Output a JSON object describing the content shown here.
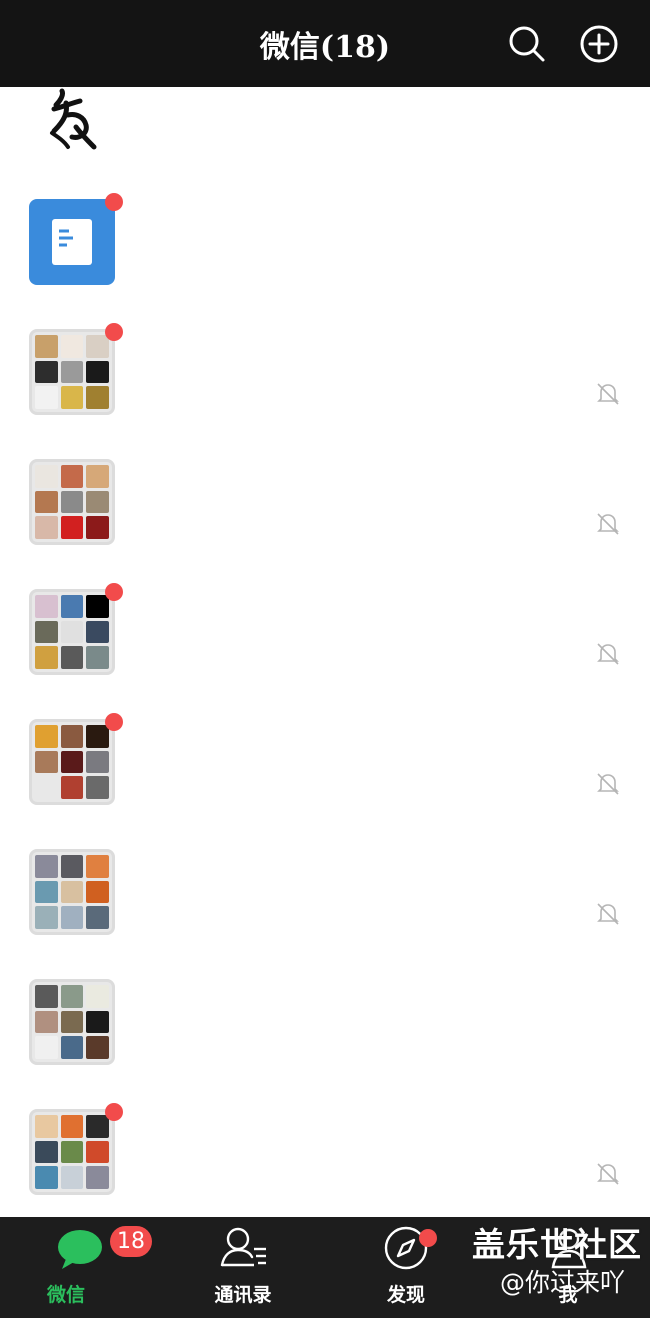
{
  "header": {
    "title": "微信(18)",
    "search_icon": "search-icon",
    "add_icon": "plus-circle-icon"
  },
  "colors": {
    "header_bg": "#141414",
    "tabbar_bg": "#1d1d1d",
    "accent_green": "#2bbf5d",
    "badge_red": "#f24b4b",
    "doc_avatar_blue": "#3a8bdc"
  },
  "chats": [
    {
      "avatar": "calligraphy-image",
      "unread_dot": false,
      "muted": false
    },
    {
      "avatar": "document-icon",
      "unread_dot": true,
      "muted": false
    },
    {
      "avatar": "group-grid",
      "unread_dot": true,
      "muted": true
    },
    {
      "avatar": "group-grid",
      "unread_dot": false,
      "muted": true
    },
    {
      "avatar": "group-grid",
      "unread_dot": true,
      "muted": true
    },
    {
      "avatar": "group-grid",
      "unread_dot": true,
      "muted": true
    },
    {
      "avatar": "group-grid",
      "unread_dot": false,
      "muted": true
    },
    {
      "avatar": "group-grid",
      "unread_dot": false,
      "muted": false
    },
    {
      "avatar": "group-grid",
      "unread_dot": true,
      "muted": true
    }
  ],
  "tabs": [
    {
      "label": "微信",
      "icon": "chat-bubble-icon",
      "active": true,
      "badge": "18"
    },
    {
      "label": "通讯录",
      "icon": "contacts-icon",
      "active": false
    },
    {
      "label": "发现",
      "icon": "compass-icon",
      "active": false,
      "dot": true
    },
    {
      "label": "我",
      "icon": "person-icon",
      "active": false
    }
  ],
  "watermark": {
    "line1": "盖乐世社区",
    "line2": "@你过来吖"
  }
}
